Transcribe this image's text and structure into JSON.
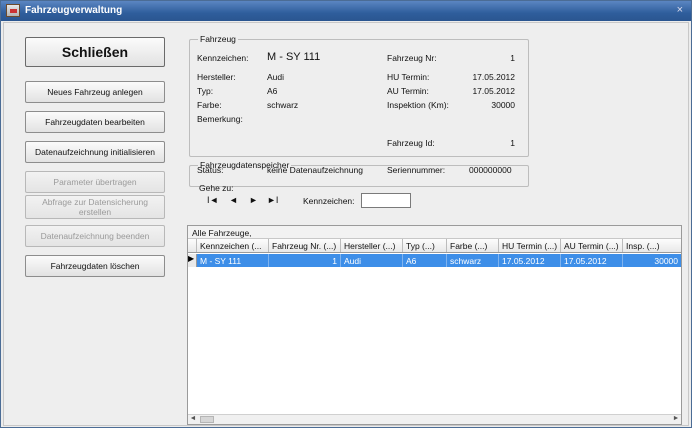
{
  "window": {
    "title": "Fahrzeugverwaltung",
    "close_glyph": "×"
  },
  "buttons": {
    "close": "Schließen",
    "new_vehicle": "Neues Fahrzeug anlegen",
    "edit_vehicle": "Fahrzeugdaten bearbeiten",
    "init_recording": "Datenaufzeichnung initialisieren",
    "transfer_params": "Parameter übertragen",
    "backup_query": "Abfrage zur Datensicherung erstellen",
    "end_recording": "Datenaufzeichnung beenden",
    "delete_vehicle": "Fahrzeugdaten löschen"
  },
  "vehicle": {
    "legend": "Fahrzeug",
    "plate_label": "Kennzeichen:",
    "plate": "M - SY 111",
    "number_label": "Fahrzeug Nr:",
    "number": "1",
    "maker_label": "Hersteller:",
    "maker": "Audi",
    "hu_label": "HU Termin:",
    "hu": "17.05.2012",
    "type_label": "Typ:",
    "type": "A6",
    "au_label": "AU Termin:",
    "au": "17.05.2012",
    "color_label": "Farbe:",
    "color": "schwarz",
    "insp_label": "Inspektion (Km):",
    "insp": "30000",
    "remark_label": "Bemerkung:",
    "id_label": "Fahrzeug Id:",
    "id": "1"
  },
  "storage": {
    "legend": "Fahrzeugdatenspeicher",
    "status_label": "Status:",
    "status": "keine Datenaufzeichnung",
    "serial_label": "Seriennummer:",
    "serial": "000000000"
  },
  "goto": {
    "legend": "Gehe zu:",
    "first": "I◄",
    "prev": "◄",
    "next": "►",
    "last": "►I",
    "plate_label": "Kennzeichen:",
    "plate_value": ""
  },
  "grid": {
    "caption": "Alle Fahrzeuge,",
    "columns": [
      "Kennzeichen (...",
      "Fahrzeug Nr. (...)",
      "Hersteller (...)",
      "Typ (...)",
      "Farbe (...)",
      "HU Termin (...)",
      "AU Termin (...)",
      "Insp. (...)"
    ],
    "rows": [
      {
        "indicator": "▶",
        "cells": [
          "M - SY 111",
          "1",
          "Audi",
          "A6",
          "schwarz",
          "17.05.2012",
          "17.05.2012",
          "30000"
        ]
      }
    ],
    "scroll_left": "◄",
    "scroll_right": "►"
  }
}
